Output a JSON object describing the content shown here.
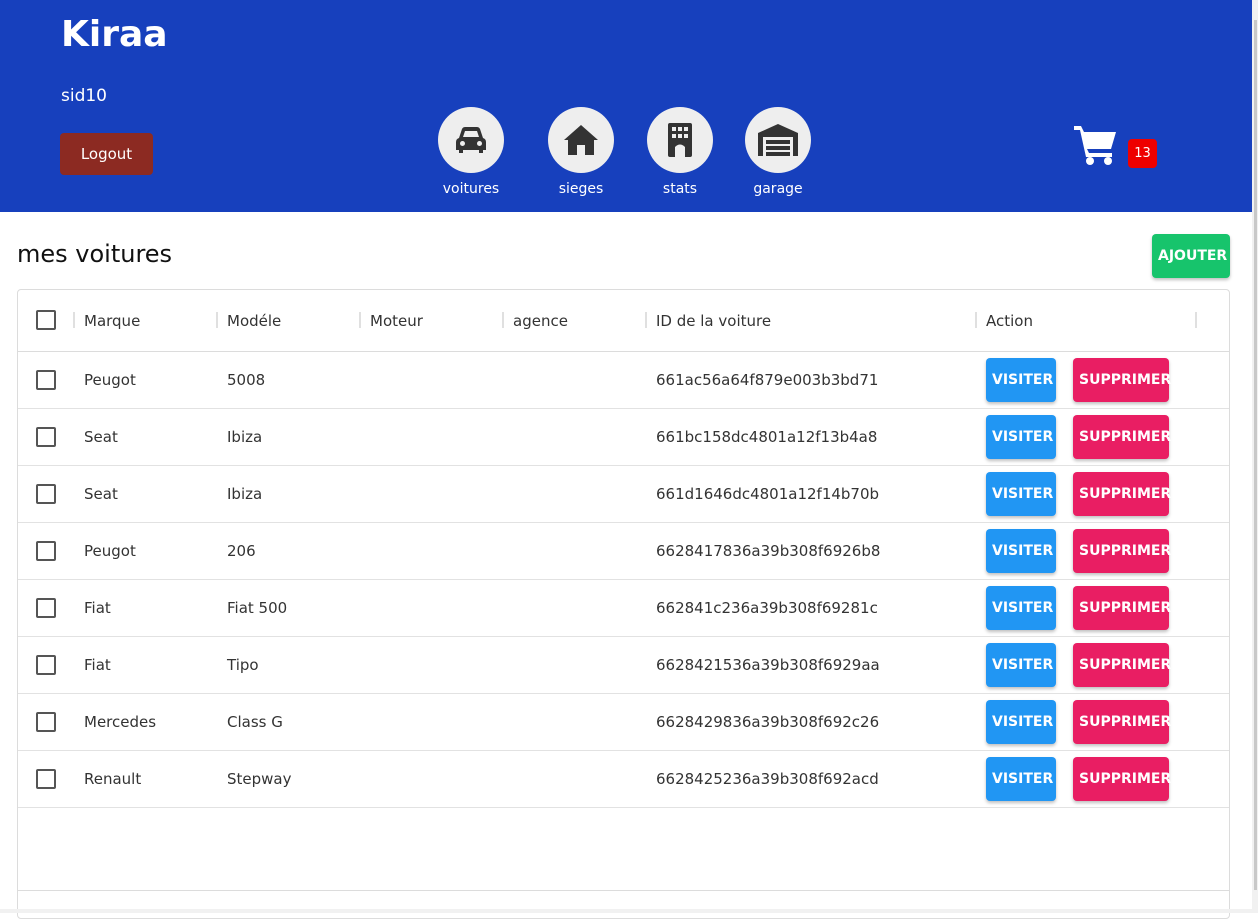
{
  "header": {
    "brand": "Kiraa",
    "username": "sid10",
    "logout_label": "Logout",
    "nav": [
      {
        "label": "voitures",
        "icon": "car-icon"
      },
      {
        "label": "sieges",
        "icon": "home-icon"
      },
      {
        "label": "stats",
        "icon": "building-icon"
      },
      {
        "label": "garage",
        "icon": "garage-icon"
      }
    ],
    "cart_count": "13",
    "colors": {
      "background": "#1740bd",
      "logout": "#8c2a22",
      "badge": "#ee0000"
    }
  },
  "main": {
    "title": "mes voitures",
    "add_label": "AJOUTER",
    "columns": [
      "Marque",
      "Modéle",
      "Moteur",
      "agence",
      "ID de la voiture",
      "Action"
    ],
    "visit_label": "VISITER",
    "delete_label": "SUPPRIMER",
    "rows": [
      {
        "marque": "Peugot",
        "modele": "5008",
        "moteur": "",
        "agence": "",
        "id": "661ac56a64f879e003b3bd71"
      },
      {
        "marque": "Seat",
        "modele": "Ibiza",
        "moteur": "",
        "agence": "",
        "id": "661bc158dc4801a12f13b4a8"
      },
      {
        "marque": "Seat",
        "modele": "Ibiza",
        "moteur": "",
        "agence": "",
        "id": "661d1646dc4801a12f14b70b"
      },
      {
        "marque": "Peugot",
        "modele": "206",
        "moteur": "",
        "agence": "",
        "id": "6628417836a39b308f6926b8"
      },
      {
        "marque": "Fiat",
        "modele": "Fiat 500",
        "moteur": "",
        "agence": "",
        "id": "662841c236a39b308f69281c"
      },
      {
        "marque": "Fiat",
        "modele": "Tipo",
        "moteur": "",
        "agence": "",
        "id": "6628421536a39b308f6929aa"
      },
      {
        "marque": "Mercedes",
        "modele": "Class G",
        "moteur": "",
        "agence": "",
        "id": "6628429836a39b308f692c26"
      },
      {
        "marque": "Renault",
        "modele": "Stepway",
        "moteur": "",
        "agence": "",
        "id": "6628425236a39b308f692acd"
      }
    ],
    "colors": {
      "add": "#17c46c",
      "visit": "#2196f3",
      "delete": "#e91e63"
    }
  }
}
